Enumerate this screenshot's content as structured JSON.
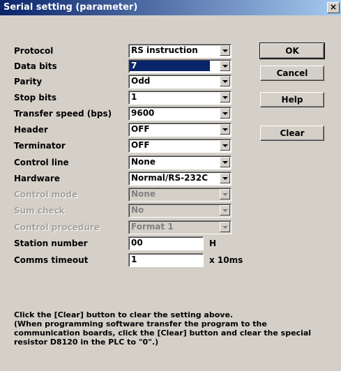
{
  "window": {
    "title": "Serial setting (parameter)",
    "close_glyph": "×"
  },
  "fields": [
    {
      "label": "Protocol",
      "value": "RS instruction"
    },
    {
      "label": "Data bits",
      "value": "7"
    },
    {
      "label": "Parity",
      "value": "Odd"
    },
    {
      "label": "Stop bits",
      "value": "1"
    },
    {
      "label": "Transfer speed (bps)",
      "value": "9600"
    },
    {
      "label": "Header",
      "value": "OFF"
    },
    {
      "label": "Terminator",
      "value": "OFF"
    },
    {
      "label": "Control line",
      "value": "None"
    },
    {
      "label": "Hardware",
      "value": "Normal/RS-232C"
    },
    {
      "label": "Control mode",
      "value": "None"
    },
    {
      "label": "Sum check",
      "value": "No"
    },
    {
      "label": "Control procedure",
      "value": "Format 1"
    }
  ],
  "station": {
    "label": "Station number",
    "value": "00",
    "unit": "H"
  },
  "timeout": {
    "label": "Comms timeout",
    "value": "1",
    "unit": "x 10ms"
  },
  "buttons": {
    "ok": "OK",
    "cancel": "Cancel",
    "help": "Help",
    "clear": "Clear"
  },
  "note": "Click the [Clear] button to clear the setting above.\n(When programming software transfer the program to the communication boards, click the [Clear] button and clear the special resistor D8120 in the PLC to \"0\".)"
}
